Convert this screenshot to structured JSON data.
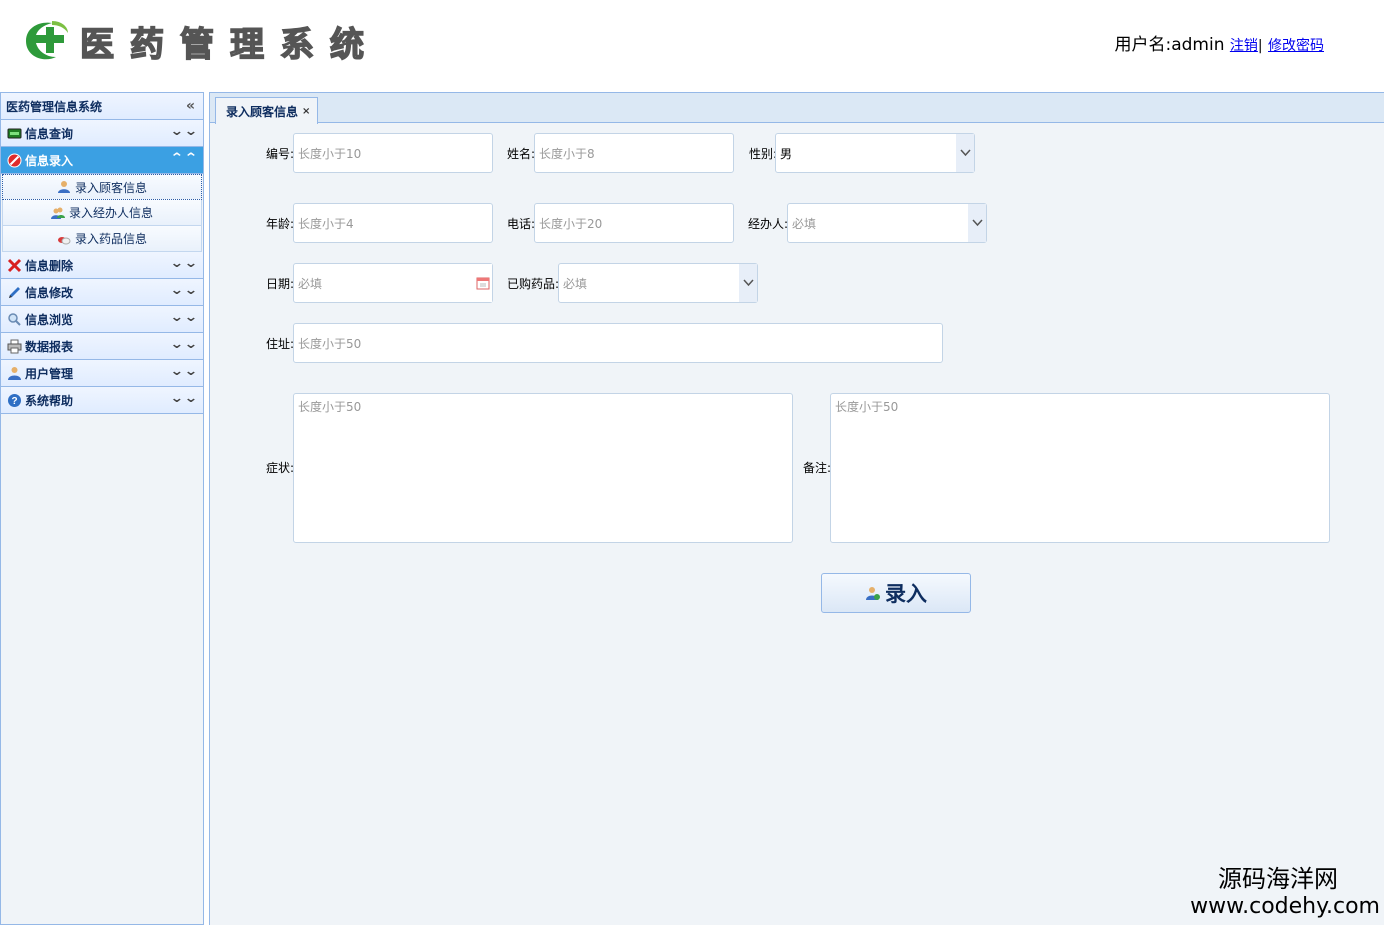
{
  "header": {
    "logo_text": "医药管理系统",
    "user_label": "用户名:admin",
    "logout_link": "注销",
    "separator": "|",
    "change_password_link": "修改密码"
  },
  "sidebar": {
    "title": "医药管理信息系统",
    "sections": [
      {
        "label": "信息查询",
        "icon": "screen-icon",
        "active": false
      },
      {
        "label": "信息录入",
        "icon": "no-entry-icon",
        "active": true,
        "items": [
          {
            "label": "录入顾客信息",
            "icon": "user-icon"
          },
          {
            "label": "录入经办人信息",
            "icon": "users-icon"
          },
          {
            "label": "录入药品信息",
            "icon": "pills-icon"
          }
        ]
      },
      {
        "label": "信息删除",
        "icon": "red-x-icon",
        "active": false
      },
      {
        "label": "信息修改",
        "icon": "pencil-icon",
        "active": false
      },
      {
        "label": "信息浏览",
        "icon": "magnifier-icon",
        "active": false
      },
      {
        "label": "数据报表",
        "icon": "printer-icon",
        "active": false
      },
      {
        "label": "用户管理",
        "icon": "user-admin-icon",
        "active": false
      },
      {
        "label": "系统帮助",
        "icon": "help-icon",
        "active": false
      }
    ]
  },
  "tab": {
    "label": "录入顾客信息",
    "close": "×"
  },
  "form": {
    "id": {
      "label": "编号:",
      "placeholder": "长度小于10"
    },
    "name": {
      "label": "姓名:",
      "placeholder": "长度小于8"
    },
    "gender": {
      "label": "性别:",
      "value": "男"
    },
    "age": {
      "label": "年龄:",
      "placeholder": "长度小于4"
    },
    "phone": {
      "label": "电话:",
      "placeholder": "长度小于20"
    },
    "agent": {
      "label": "经办人:",
      "placeholder": "必填"
    },
    "date": {
      "label": "日期:",
      "placeholder": "必填"
    },
    "medicine": {
      "label": "已购药品:",
      "placeholder": "必填"
    },
    "address": {
      "label": "住址:",
      "placeholder": "长度小于50"
    },
    "symptom": {
      "label": "症状:",
      "placeholder": "长度小于50"
    },
    "remark": {
      "label": "备注:",
      "placeholder": "长度小于50"
    },
    "submit_label": "录入"
  },
  "watermark": {
    "line1": "源码海洋网",
    "line2": "www.codehy.com"
  },
  "colors": {
    "accent": "#3ba0e3",
    "border": "#95b8e7",
    "panel": "#f0f4f8"
  }
}
